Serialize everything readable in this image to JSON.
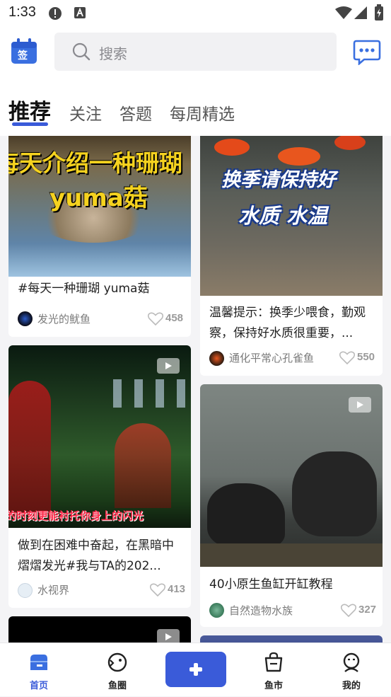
{
  "status_bar": {
    "time": "1:33"
  },
  "header": {
    "search_placeholder": "搜索",
    "checkin_icon_text": "签"
  },
  "tabs": [
    {
      "label": "推荐",
      "active": true
    },
    {
      "label": "关注"
    },
    {
      "label": "答题"
    },
    {
      "label": "每周精选"
    }
  ],
  "feed": {
    "left": [
      {
        "title": "#每天一种珊瑚 yuma菇",
        "author": "发光的鱿鱼",
        "likes": "458",
        "overlay_line1": "每天介绍一种珊瑚",
        "overlay_line2": "yuma菇"
      },
      {
        "title": "做到在困难中奋起，在黑暗中熠熠发光#我与TA的202...",
        "author": "水视界",
        "likes": "413",
        "overlay_caption": "的时刻更能衬托你身上的闪光",
        "video": true
      },
      {
        "video": true
      }
    ],
    "right": [
      {
        "title": "温馨提示：换季少喂食，勤观察，保持好水质很重要，...",
        "author": "通化平常心孔雀鱼",
        "likes": "550",
        "overlay_line1": "换季请保持好",
        "overlay_line2": "水质  水温"
      },
      {
        "title": "40小原生鱼缸开缸教程",
        "author": "自然造物水族",
        "likes": "327",
        "video": true
      },
      {}
    ]
  },
  "bottom_nav": [
    {
      "label": "首页",
      "active": true
    },
    {
      "label": "鱼圈"
    },
    {
      "label": ""
    },
    {
      "label": "鱼市"
    },
    {
      "label": "我的"
    }
  ],
  "colors": {
    "accent": "#3a5bd9",
    "overlay_yellow": "#f5d21f"
  }
}
